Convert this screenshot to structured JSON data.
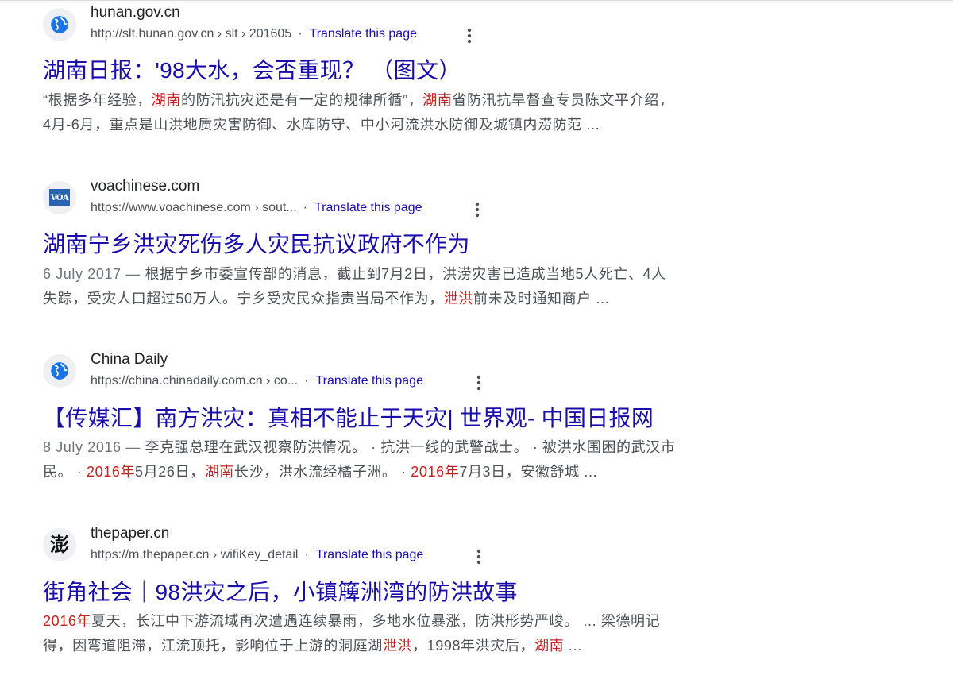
{
  "colors": {
    "title_link": "#1a0dab",
    "snippet_text": "#4d5156",
    "highlight": "#c5221f",
    "date": "#70757a"
  },
  "results": [
    {
      "icon": "globe-icon",
      "site_name": "hunan.gov.cn",
      "url": "http://slt.hunan.gov.cn › slt › 201605",
      "translate": "Translate this page",
      "title": "湖南日报：'98大水，会否重现？ （图文）",
      "snippet_line_1": [
        {
          "text": "“根据多年经验，",
          "hl": false
        },
        {
          "text": "湖南",
          "hl": true
        },
        {
          "text": "的防汛抗灾还是有一定的规律所循”，",
          "hl": false
        },
        {
          "text": "湖南",
          "hl": true
        },
        {
          "text": "省防汛抗旱督查专员陈文平介绍，",
          "hl": false
        }
      ],
      "snippet_line_2": [
        {
          "text": "4月-6月，重点是山洪地质灾害防御、水库防守、中小河流洪水防御及城镇内涝防范 ...",
          "hl": false
        }
      ]
    },
    {
      "icon": "voa-logo-icon",
      "icon_text": "VOA",
      "site_name": "voachinese.com",
      "url": "https://www.voachinese.com › sout...",
      "translate": "Translate this page",
      "title": "湖南宁乡洪灾死伤多人灾民抗议政府不作为",
      "date": "6 July 2017 — ",
      "snippet_line_1": [
        {
          "text": "根据宁乡市委宣传部的消息，截止到7月2日，洪涝灾害已造成当地5人死亡、4人",
          "hl": false
        }
      ],
      "snippet_line_2": [
        {
          "text": "失踪，受灾人口超过50万人。宁乡受灾民众指责当局不作为，",
          "hl": false
        },
        {
          "text": "泄洪",
          "hl": true
        },
        {
          "text": "前未及时通知商户 ...",
          "hl": false
        }
      ]
    },
    {
      "icon": "globe-icon",
      "site_name": "China Daily",
      "url": "https://china.chinadaily.com.cn › co...",
      "translate": "Translate this page",
      "title": "【传媒汇】南方洪灾：真相不能止于天灾| 世界观- 中国日报网",
      "date": "8 July 2016 — ",
      "snippet_line_1": [
        {
          "text": "李克强总理在武汉视察防洪情况。 · 抗洪一线的武警战士。 · 被洪水围困的武汉市",
          "hl": false
        }
      ],
      "snippet_line_2": [
        {
          "text": "民。 · ",
          "hl": false
        },
        {
          "text": "2016年",
          "hl": true
        },
        {
          "text": "5月26日，",
          "hl": false
        },
        {
          "text": "湖南",
          "hl": true
        },
        {
          "text": "长沙，洪水流经橘子洲。 · ",
          "hl": false
        },
        {
          "text": "2016年",
          "hl": true
        },
        {
          "text": "7月3日，安徽舒城 ...",
          "hl": false
        }
      ]
    },
    {
      "icon": "thepaper-logo-icon",
      "icon_text": "澎",
      "site_name": "thepaper.cn",
      "url": "https://m.thepaper.cn › wifiKey_detail",
      "translate": "Translate this page",
      "title": "街角社会｜98洪灾之后，小镇簰洲湾的防洪故事",
      "snippet_line_1": [
        {
          "text": "2016年",
          "hl": true
        },
        {
          "text": "夏天，长江中下游流域再次遭遇连续暴雨，多地水位暴涨，防洪形势严峻。 ... 梁德明记",
          "hl": false
        }
      ],
      "snippet_line_2": [
        {
          "text": "得，因弯道阻滞，江流顶托，影响位于上游的洞庭湖",
          "hl": false
        },
        {
          "text": "泄洪",
          "hl": true
        },
        {
          "text": "，1998年洪灾后，",
          "hl": false
        },
        {
          "text": "湖南",
          "hl": true
        },
        {
          "text": " ...",
          "hl": false
        }
      ]
    }
  ]
}
